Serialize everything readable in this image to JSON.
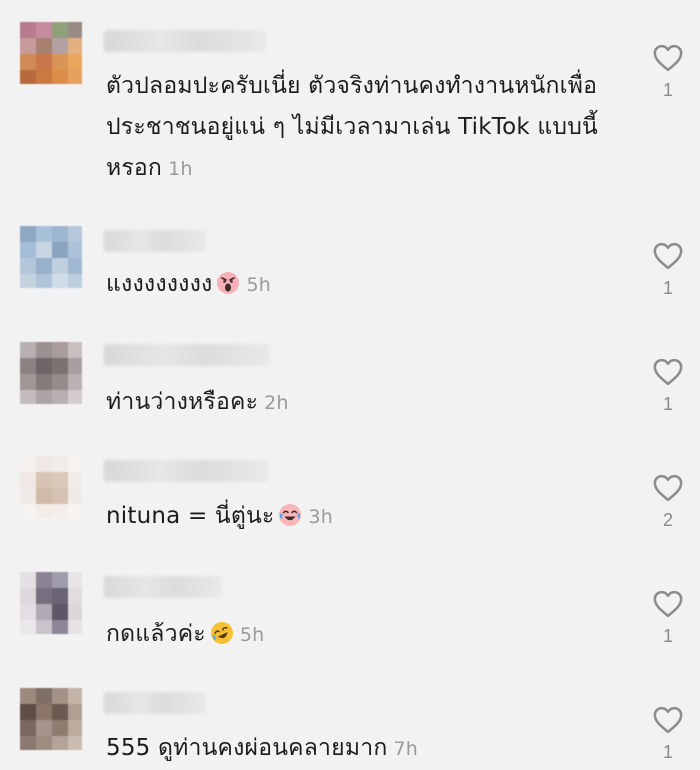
{
  "comments": [
    {
      "text": "ตัวปลอมปะครับเนี่ย ตัวจริงท่านคงทำงานหนักเพื่อประชาชนอยู่แน่ ๆ ไม่มีเวลามาเล่น TikTok แบบนี้หรอก",
      "time": "1h",
      "likes": "1",
      "emoji": null
    },
    {
      "text": "แงงงงงงงง",
      "time": "5h",
      "likes": "1",
      "emoji": "screaming-face"
    },
    {
      "text": "ท่านว่างหรือคะ",
      "time": "2h",
      "likes": "1",
      "emoji": null
    },
    {
      "text": "nituna = นี่ตู่นะ",
      "time": "3h",
      "likes": "2",
      "emoji": "face-with-tears-of-joy"
    },
    {
      "text": "กดแล้วค่ะ",
      "time": "5h",
      "likes": "1",
      "emoji": "rolling-on-floor-laughing"
    },
    {
      "text": "555 ดูท่านคงผ่อนคลายมาก",
      "time": "7h",
      "likes": "1",
      "emoji": null
    }
  ],
  "colors": {
    "background": "#f2f2f2",
    "text": "#1c1c1c",
    "timestamp": "#9a9a9a",
    "like_count": "#8a8a8a",
    "heart_outline": "#8c8c8c"
  }
}
